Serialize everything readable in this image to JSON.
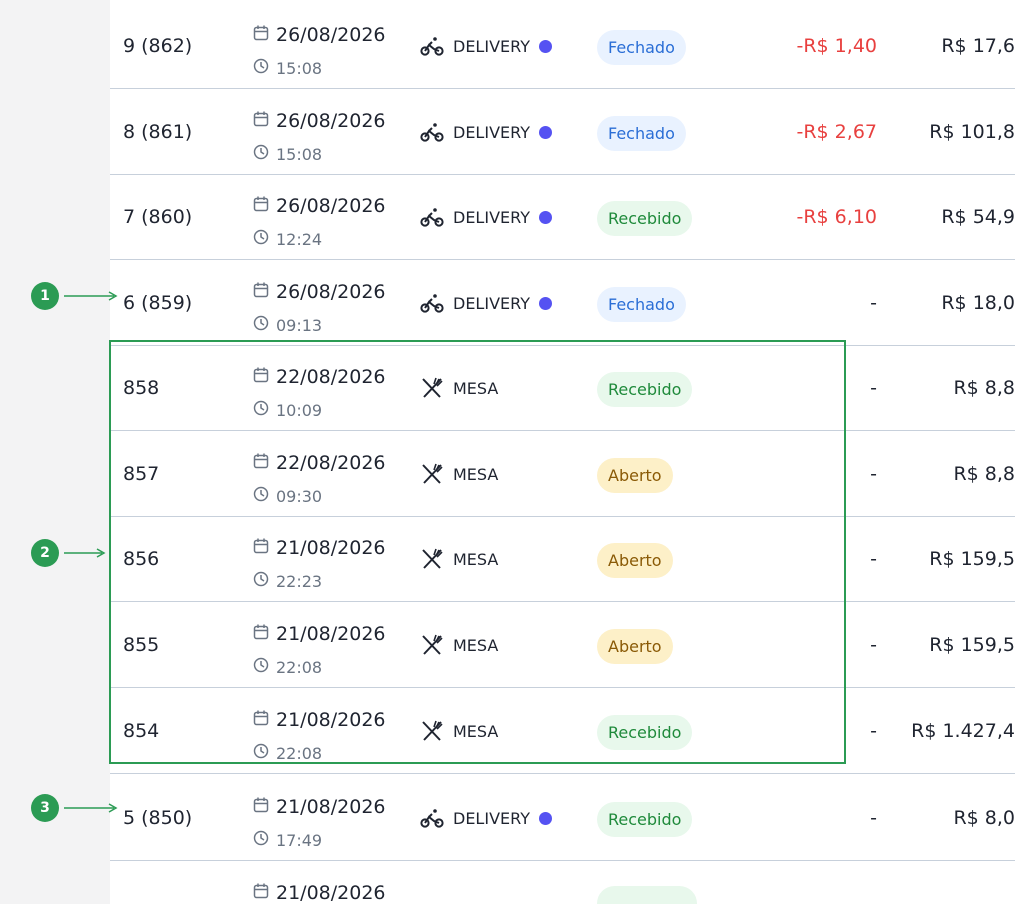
{
  "colors": {
    "accent_green": "#2b9b54",
    "delivery_dot": "#5552f2",
    "negative": "#e8403f",
    "badge_fechado": "#2a6ed6",
    "badge_recebido": "#1f8a3b",
    "badge_aberto": "#8a5a06"
  },
  "orders": [
    {
      "order": "9 (862)",
      "date": "26/08/2026",
      "time": "15:08",
      "type": "DELIVERY",
      "type_icon": "bicycle-icon",
      "status": "Fechado",
      "status_kind": "fechado",
      "discount": "-R$ 1,40",
      "total": "R$ 17,6"
    },
    {
      "order": "8 (861)",
      "date": "26/08/2026",
      "time": "15:08",
      "type": "DELIVERY",
      "type_icon": "bicycle-icon",
      "status": "Fechado",
      "status_kind": "fechado",
      "discount": "-R$ 2,67",
      "total": "R$ 101,8"
    },
    {
      "order": "7 (860)",
      "date": "26/08/2026",
      "time": "12:24",
      "type": "DELIVERY",
      "type_icon": "bicycle-icon",
      "status": "Recebido",
      "status_kind": "recebido",
      "discount": "-R$ 6,10",
      "total": "R$ 54,9"
    },
    {
      "order": "6 (859)",
      "date": "26/08/2026",
      "time": "09:13",
      "type": "DELIVERY",
      "type_icon": "bicycle-icon",
      "status": "Fechado",
      "status_kind": "fechado",
      "discount": "-",
      "total": "R$ 18,0"
    },
    {
      "order": "858",
      "date": "22/08/2026",
      "time": "10:09",
      "type": "MESA",
      "type_icon": "cutlery-icon",
      "status": "Recebido",
      "status_kind": "recebido",
      "discount": "-",
      "total": "R$ 8,8"
    },
    {
      "order": "857",
      "date": "22/08/2026",
      "time": "09:30",
      "type": "MESA",
      "type_icon": "cutlery-icon",
      "status": "Aberto",
      "status_kind": "aberto",
      "discount": "-",
      "total": "R$ 8,8"
    },
    {
      "order": "856",
      "date": "21/08/2026",
      "time": "22:23",
      "type": "MESA",
      "type_icon": "cutlery-icon",
      "status": "Aberto",
      "status_kind": "aberto",
      "discount": "-",
      "total": "R$ 159,5"
    },
    {
      "order": "855",
      "date": "21/08/2026",
      "time": "22:08",
      "type": "MESA",
      "type_icon": "cutlery-icon",
      "status": "Aberto",
      "status_kind": "aberto",
      "discount": "-",
      "total": "R$ 159,5"
    },
    {
      "order": "854",
      "date": "21/08/2026",
      "time": "22:08",
      "type": "MESA",
      "type_icon": "cutlery-icon",
      "status": "Recebido",
      "status_kind": "recebido",
      "discount": "-",
      "total": "R$ 1.427,4"
    },
    {
      "order": "5 (850)",
      "date": "21/08/2026",
      "time": "17:49",
      "type": "DELIVERY",
      "type_icon": "bicycle-icon",
      "status": "Recebido",
      "status_kind": "recebido",
      "discount": "-",
      "total": "R$ 8,0"
    },
    {
      "order": "",
      "date": "21/08/2026",
      "time": "",
      "type": "",
      "type_icon": "",
      "status": "",
      "status_kind": "recebido",
      "discount": "",
      "total": ""
    }
  ],
  "annotations": [
    {
      "label": "1"
    },
    {
      "label": "2"
    },
    {
      "label": "3"
    }
  ]
}
